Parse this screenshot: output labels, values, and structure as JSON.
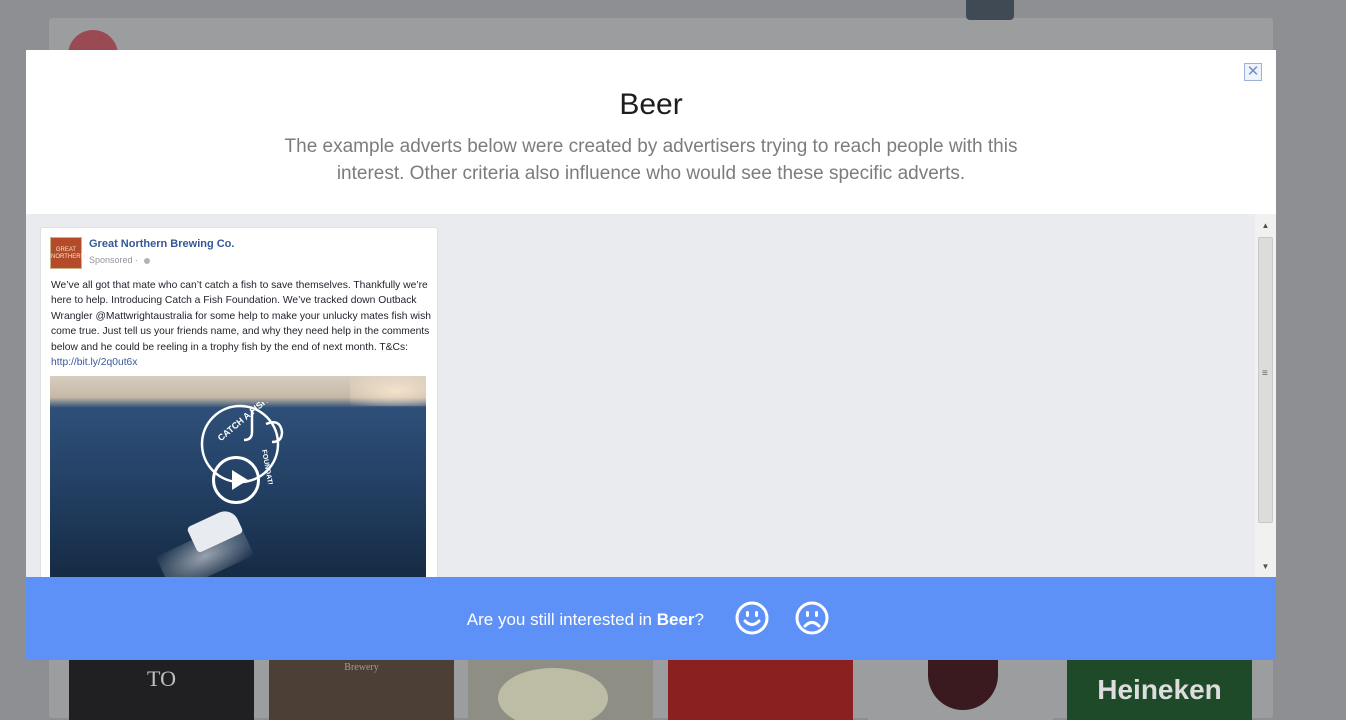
{
  "modal": {
    "title": "Beer",
    "subtitle": "The example adverts below were created by advertisers trying to reach people with this interest. Other criteria also influence who would see these specific adverts.",
    "close_label": "✕"
  },
  "ad": {
    "page_name": "Great Northern Brewing Co.",
    "logo_text": "GREAT NORTHERN",
    "sponsored": "Sponsored",
    "separator": "·",
    "body": "We’ve all got that mate who can’t catch a fish to save themselves. Thankfully we’re here to help. Introducing Catch a Fish Foundation. We’ve tracked down Outback Wrangler @Mattwrightaustralia for some help to make your unlucky mates fish wish come true. Just tell us your friends name, and why they need help in the comments below and he could be reeling in a trophy fish by the end of next month. T&Cs: ",
    "link": "http://bit.ly/2q0ut6x",
    "video_logo_top": "CATCH A FISH",
    "video_logo_side": "FOUNDATION"
  },
  "footer": {
    "question_prefix": "Are you still interested in ",
    "interest": "Beer",
    "question_suffix": "?"
  },
  "background": {
    "tile1_text": "TO",
    "tile2_text": "Brewery",
    "tile6_text": "Heineken"
  },
  "colors": {
    "footer_bg": "#5d91f7",
    "link": "#365899"
  }
}
